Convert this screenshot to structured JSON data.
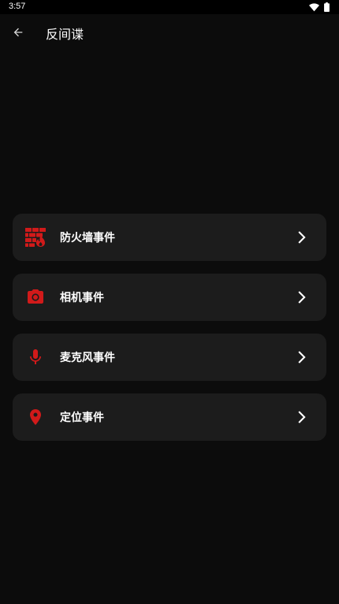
{
  "status_bar": {
    "time": "3:57",
    "icons": [
      "wifi-icon",
      "battery-icon"
    ]
  },
  "app_bar": {
    "back_icon": "arrow-back-icon",
    "title": "反间谍"
  },
  "theme": {
    "accent": "#d11a1a",
    "card_bg": "#1c1c1c",
    "page_bg": "#0c0c0c"
  },
  "menu": {
    "items": [
      {
        "label": "防火墙事件",
        "icon": "firewall-icon"
      },
      {
        "label": "相机事件",
        "icon": "camera-icon"
      },
      {
        "label": "麦克风事件",
        "icon": "microphone-icon"
      },
      {
        "label": "定位事件",
        "icon": "location-pin-icon"
      }
    ]
  }
}
